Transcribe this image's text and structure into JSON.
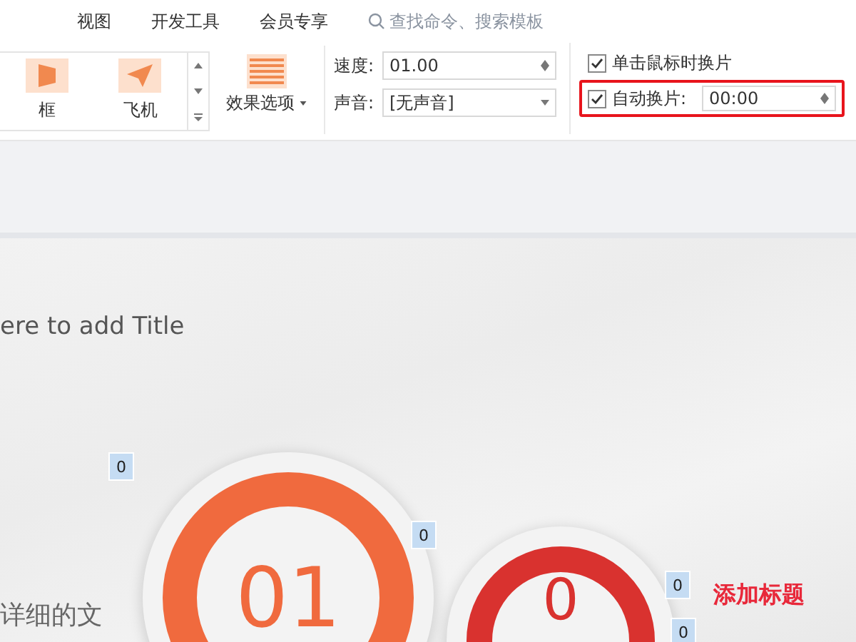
{
  "menu": [
    {
      "label": "视图"
    },
    {
      "label": "开发工具"
    },
    {
      "label": "会员专享"
    }
  ],
  "search": {
    "placeholder": "查找命令、搜索模板"
  },
  "gallery": [
    {
      "label": "框",
      "kind": "box"
    },
    {
      "label": "飞机",
      "kind": "plane"
    }
  ],
  "effect_options": {
    "label": "效果选项"
  },
  "speed": {
    "label": "速度:",
    "value": "01.00"
  },
  "sound": {
    "label": "声音:",
    "value": "[无声音]"
  },
  "advance_on_click": {
    "label": "单击鼠标时换片",
    "checked": true
  },
  "auto_advance": {
    "label": "自动换片:",
    "checked": true,
    "value": "00:00",
    "highlighted": true
  },
  "slide": {
    "title": "ere to add Title",
    "body_text": "详细的文",
    "heading": "添加标题",
    "circles": [
      {
        "number": "01",
        "color": "#f06a3e"
      },
      {
        "number": "0",
        "color": "#d9322f"
      }
    ],
    "tags": [
      "0",
      "0",
      "0",
      "0"
    ]
  }
}
